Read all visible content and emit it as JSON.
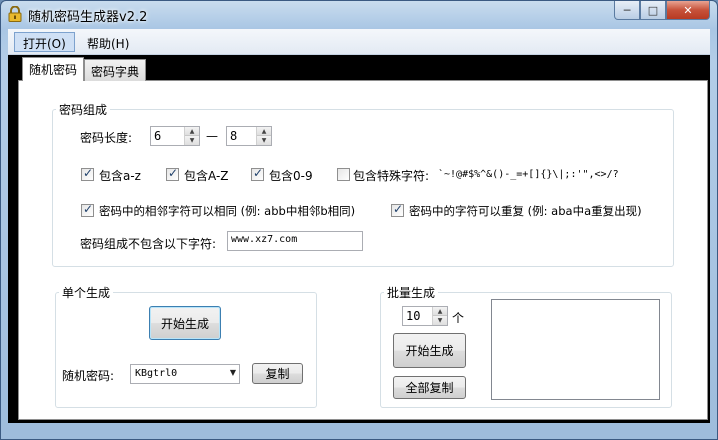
{
  "window": {
    "title": "随机密码生成器v2.2",
    "minimize": "─",
    "maximize": "□",
    "close": "✕"
  },
  "menu": {
    "open": "打开(O)",
    "help": "帮助(H)"
  },
  "tabs": [
    {
      "label": "随机密码"
    },
    {
      "label": "密码字典"
    }
  ],
  "composition": {
    "group_label": "密码组成",
    "length_label": "密码长度:",
    "length_min": "6",
    "length_dash": "—",
    "length_max": "8",
    "include_lower": {
      "label": "包含a-z",
      "checked": true
    },
    "include_upper": {
      "label": "包含A-Z",
      "checked": true
    },
    "include_digits": {
      "label": "包含0-9",
      "checked": true
    },
    "include_special": {
      "label": "包含特殊字符:",
      "checked": false
    },
    "special_chars": "`~!@#$%^&()-_=+[]{}\\|;:'\",<>/?",
    "adjacent_same": {
      "label": "密码中的相邻字符可以相同 (例: abb中相邻b相同)",
      "checked": true
    },
    "repeat_allowed": {
      "label": "密码中的字符可以重复 (例: aba中a重复出现)",
      "checked": true
    },
    "exclude_label": "密码组成不包含以下字符:",
    "exclude_value": "www.xz7.com"
  },
  "single": {
    "group_label": "单个生成",
    "generate_button": "开始生成",
    "result_label": "随机密码:",
    "result_value": "KBgtrl0",
    "copy_button": "复制"
  },
  "batch": {
    "group_label": "批量生成",
    "count_value": "10",
    "count_unit": "个",
    "generate_button": "开始生成",
    "copy_all_button": "全部复制"
  },
  "icons": {
    "app": "lock-icon",
    "spin_up": "▲",
    "spin_down": "▼",
    "dropdown": "▼"
  }
}
